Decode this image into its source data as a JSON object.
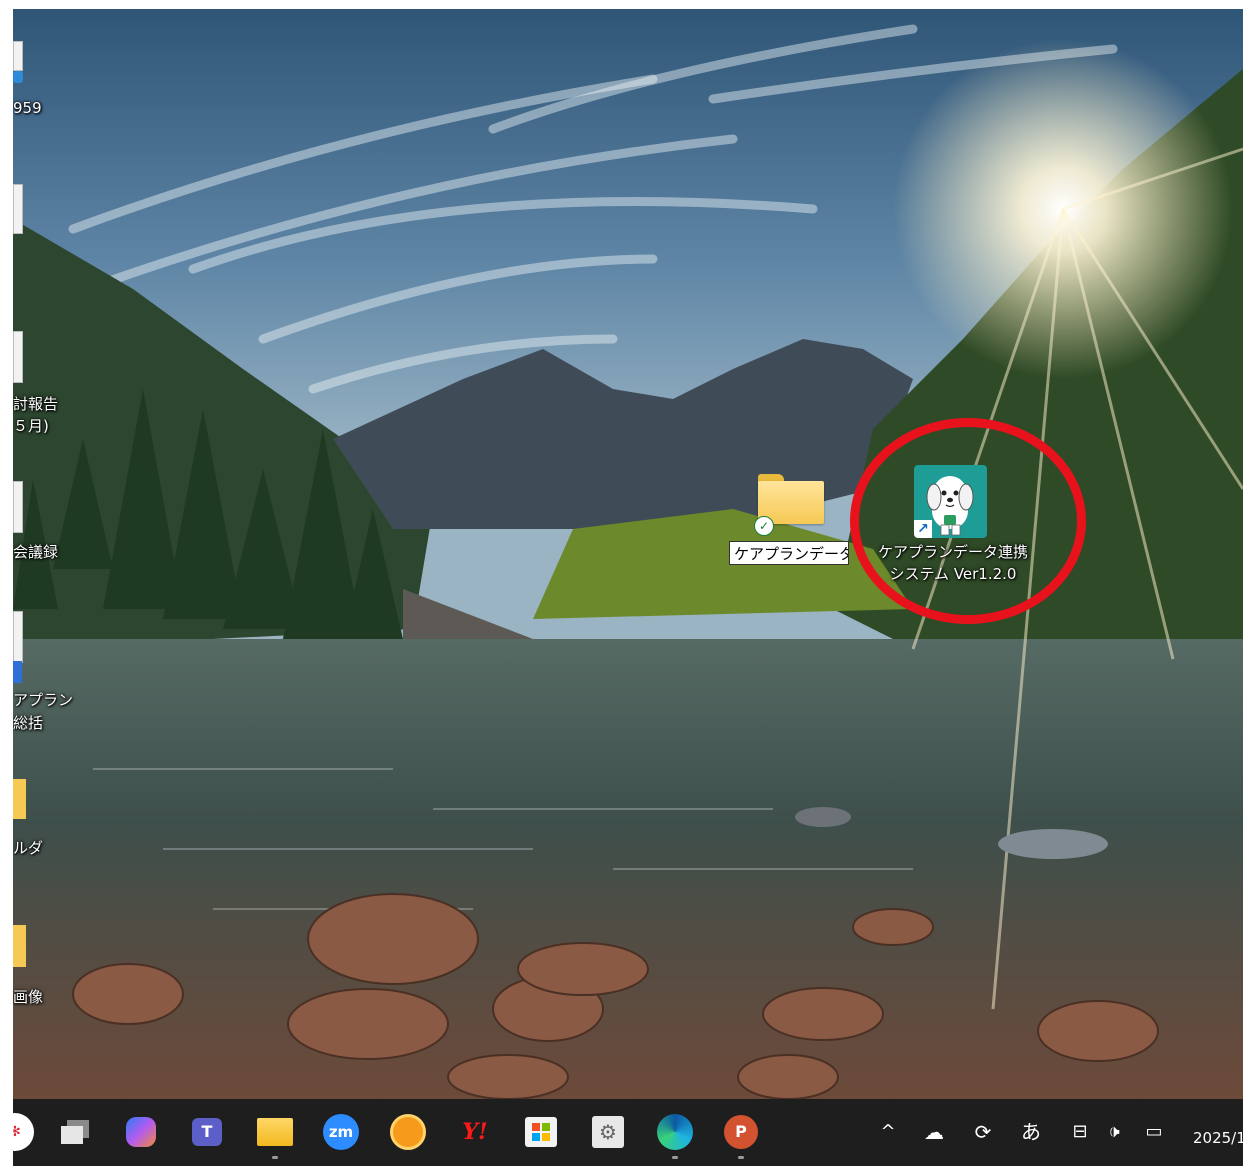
{
  "desktop": {
    "left_labels": [
      {
        "text": "959"
      },
      {
        "text": "討報告"
      },
      {
        "text": "５月)"
      },
      {
        "text": "会議録"
      },
      {
        "text": "アプラン"
      },
      {
        "text": "総括"
      },
      {
        "text": "ルダ"
      },
      {
        "text": "画像"
      }
    ],
    "folder": {
      "rename_value": "ケアプランデータ"
    },
    "app_shortcut": {
      "line1": "ケアプランデータ連携",
      "line2": "システム Ver1.2.0"
    },
    "highlight_color": "#e8121c"
  },
  "taskbar": {
    "apps": [
      {
        "icon": "start-icon"
      },
      {
        "icon": "task-view-icon"
      },
      {
        "icon": "copilot-icon"
      },
      {
        "icon": "teams-icon"
      },
      {
        "icon": "file-explorer-icon",
        "running": true
      },
      {
        "icon": "zoom-icon",
        "text": "zm"
      },
      {
        "icon": "app-orange-icon"
      },
      {
        "icon": "yahoo-icon",
        "text": "Y!"
      },
      {
        "icon": "store-icon"
      },
      {
        "icon": "settings-app-icon"
      },
      {
        "icon": "edge-icon",
        "running": true
      },
      {
        "icon": "powerpoint-icon",
        "text": "P",
        "running": true
      }
    ],
    "tray": {
      "chevron": "^",
      "ime": "あ",
      "clock": "2025/1"
    }
  }
}
